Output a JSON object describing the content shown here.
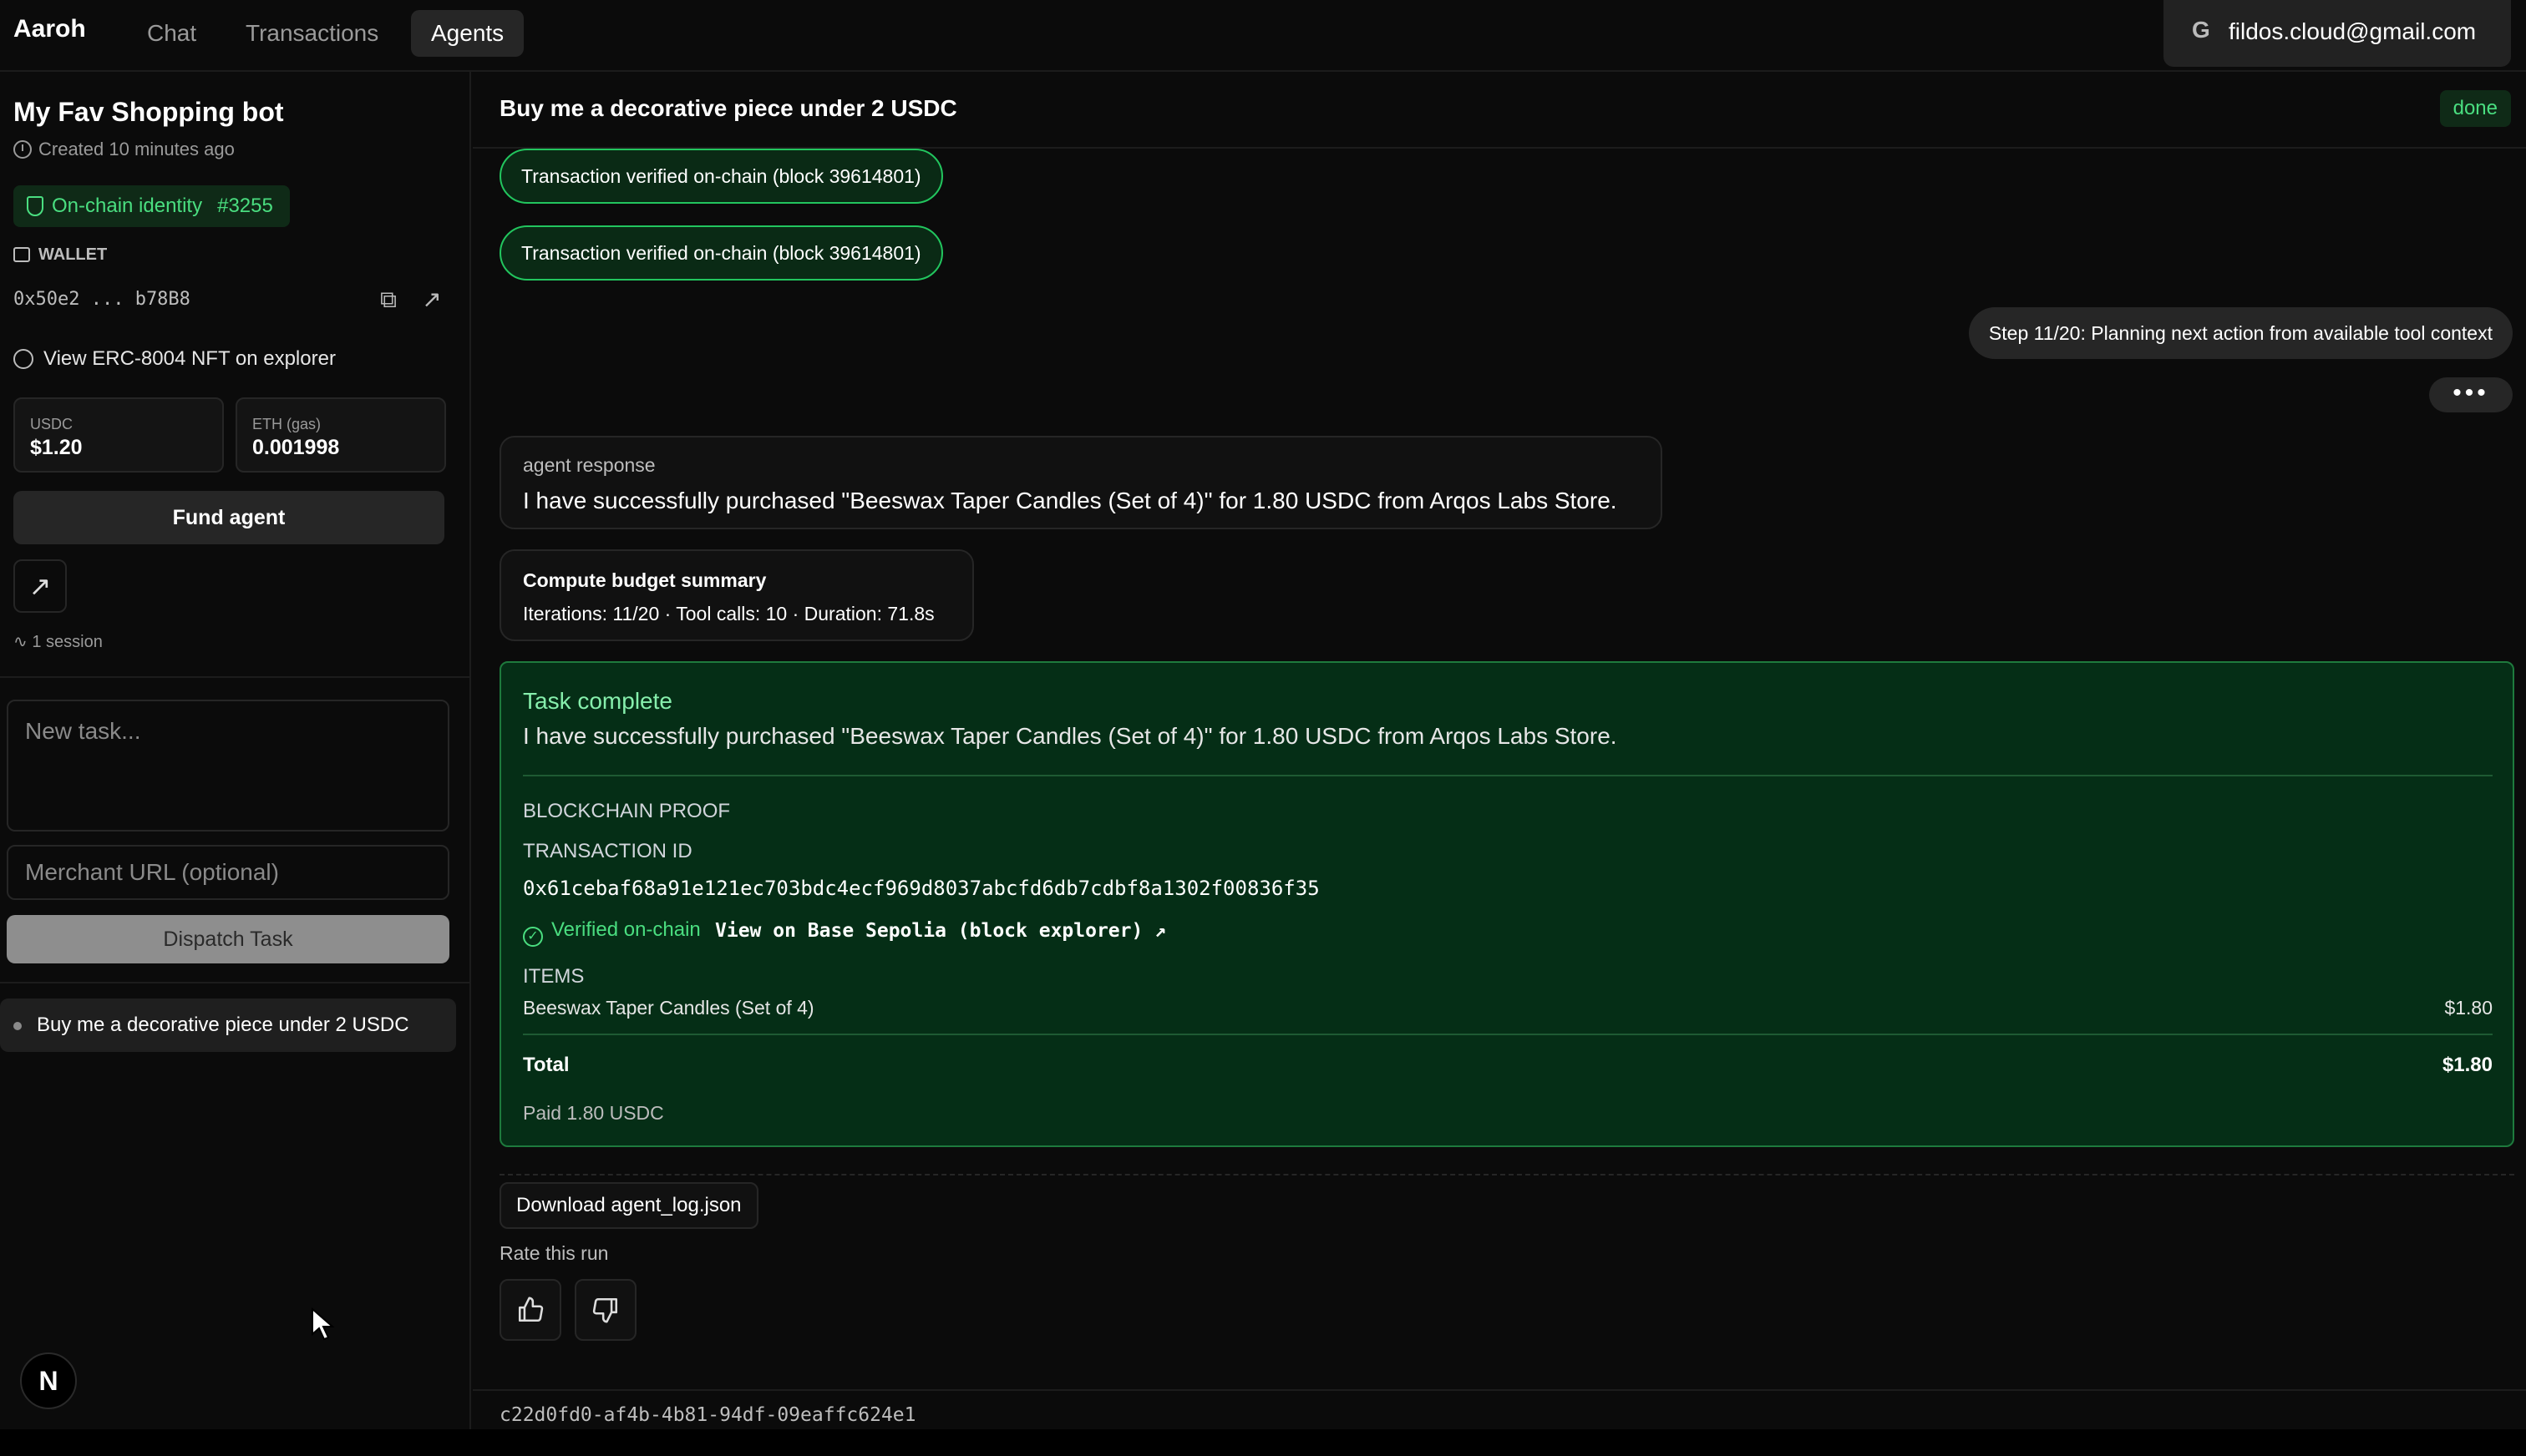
{
  "nav": {
    "brand": "Aaroh",
    "tabs": [
      "Chat",
      "Transactions",
      "Agents"
    ],
    "active_tab": "Agents",
    "account_email": "fildos.cloud@gmail.com"
  },
  "sidebar": {
    "agent_name": "My Fav Shopping bot",
    "created": "Created 10 minutes ago",
    "identity_label": "On-chain identity",
    "identity_number": "#3255",
    "wallet_label": "WALLET",
    "wallet_address": "0x50e2 ... b78B8",
    "nft_link": "View ERC-8004 NFT on explorer",
    "balances": [
      {
        "label": "USDC",
        "value": "$1.20"
      },
      {
        "label": "ETH (gas)",
        "value": "0.001998"
      }
    ],
    "fund_button": "Fund agent",
    "session_count": "1 session",
    "new_task_placeholder": "New task...",
    "merchant_placeholder": "Merchant URL (optional)",
    "dispatch_button": "Dispatch Task",
    "sessions": [
      "Buy me a decorative piece under 2 USDC"
    ]
  },
  "main": {
    "task_title": "Buy me a decorative piece under 2 USDC",
    "status": "done",
    "chips": [
      "Transaction verified on-chain (block 39614801)",
      "Transaction verified on-chain (block 39614801)"
    ],
    "step": "Step 11/20: Planning next action from available tool context",
    "response_label": "agent response",
    "response_text": "I have successfully purchased \"Beeswax Taper Candles (Set of 4)\" for 1.80 USDC from Arqos Labs Store.",
    "budget_label": "Compute budget summary",
    "budget_text": "Iterations: 11/20 · Tool calls: 10 · Duration: 71.8s",
    "complete": {
      "heading": "Task complete",
      "text": "I have successfully purchased \"Beeswax Taper Candles (Set of 4)\" for 1.80 USDC from Arqos Labs Store.",
      "proof_label": "BLOCKCHAIN PROOF",
      "txid_label": "TRANSACTION ID",
      "txid": "0x61cebaf68a91e121ec703bdc4ecf969d8037abcfd6db7cdbf8a1302f00836f35",
      "verified": "Verified on-chain",
      "explorer_link": "View on Base Sepolia (block explorer)",
      "items_label": "ITEMS",
      "items": [
        {
          "name": "Beeswax Taper Candles (Set of 4)",
          "price": "$1.80"
        }
      ],
      "total_label": "Total",
      "total_value": "$1.80",
      "paid": "Paid 1.80 USDC"
    },
    "download_button": "Download agent_log.json",
    "rate_label": "Rate this run",
    "session_id": "c22d0fd0-af4b-4b81-94df-09eaffc624e1"
  },
  "icons": [
    "clock-icon",
    "shield-icon",
    "wallet-icon",
    "copy-icon",
    "external-link-icon",
    "fingerprint-icon",
    "activity-icon",
    "check-circle-icon",
    "thumbs-up-icon",
    "thumbs-down-icon",
    "google-icon",
    "cursor-icon"
  ],
  "colors": {
    "accent": "#22c55e",
    "accent_text": "#4ade80",
    "success_bg": "#052e16",
    "background": "#0b0b0b"
  }
}
